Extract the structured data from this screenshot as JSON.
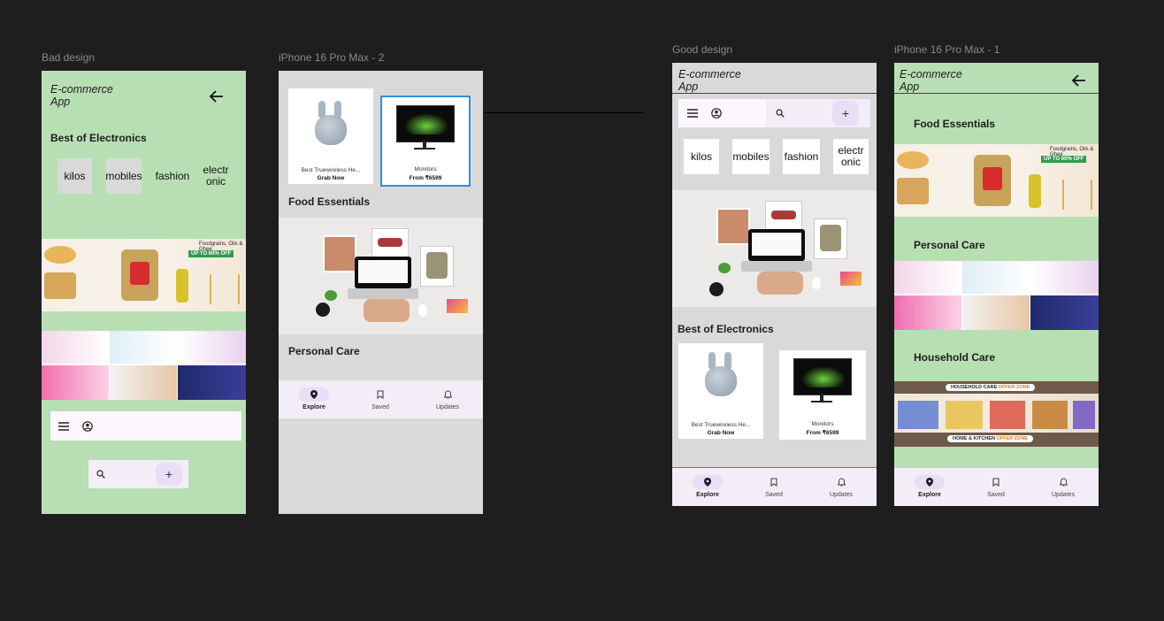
{
  "labels": {
    "bad": "Bad design",
    "iphone2": "iPhone 16 Pro Max - 2",
    "good": "Good design",
    "iphone1": "iPhone 16 Pro Max - 1"
  },
  "app": {
    "title_line1": "E-commerce",
    "title_line2": "App"
  },
  "sections": {
    "electronics": "Best of Electronics",
    "food": "Food Essentials",
    "personal": "Personal Care",
    "household": "Household Care"
  },
  "chips": [
    "kilos",
    "mobiles",
    "fashion",
    "electr",
    "onic"
  ],
  "products": {
    "earbuds_label": "Best Truewireless He...",
    "earbuds_cta": "Grab Now",
    "monitor_label": "Monitors",
    "monitor_cta": "From ₹6599"
  },
  "food_banner": {
    "heading": "Foodgrains, Oils & Ghee",
    "offer": "UP TO 60% OFF"
  },
  "household_banner": {
    "top": "HOUSEHOLD CARE",
    "top_accent": "OFFER ZONE",
    "bottom": "HOME & KITCHEN",
    "bottom_accent": "OFFER ZONE"
  },
  "nav": {
    "explore": "Explore",
    "saved": "Saved",
    "updates": "Updates"
  },
  "colors": {
    "canvas": "#1e1e1e",
    "green": "#b8dfb4",
    "grey": "#d9d9d9",
    "nav": "#f3edf7",
    "accent": "#e8def8"
  }
}
